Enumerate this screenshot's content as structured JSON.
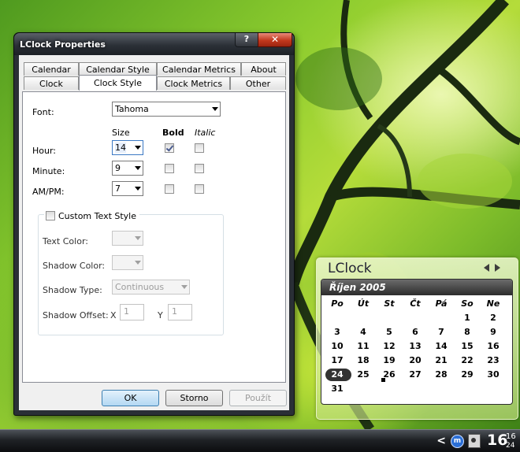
{
  "window": {
    "title": "LClock Properties",
    "help_label": "?",
    "close_label": "✕"
  },
  "tabs": {
    "row1": [
      "Calendar",
      "Calendar Style",
      "Calendar Metrics",
      "About"
    ],
    "row2": [
      "Clock",
      "Clock Style",
      "Clock Metrics",
      "Other"
    ],
    "active": "Clock Style"
  },
  "clock_style": {
    "font_label": "Font:",
    "font_value": "Tahoma",
    "size_header": "Size",
    "bold_header": "Bold",
    "italic_header": "Italic",
    "rows": [
      {
        "label": "Hour:",
        "size": "14",
        "bold": true,
        "italic": false
      },
      {
        "label": "Minute:",
        "size": "9",
        "bold": false,
        "italic": false
      },
      {
        "label": "AM/PM:",
        "size": "7",
        "bold": false,
        "italic": false
      }
    ],
    "custom_text_style_label": "Custom Text Style",
    "custom_text_style_checked": false,
    "text_color_label": "Text Color:",
    "shadow_color_label": "Shadow Color:",
    "shadow_type_label": "Shadow Type:",
    "shadow_type_value": "Continuous",
    "shadow_offset_label": "Shadow Offset:",
    "offset_x_label": "X",
    "offset_x_value": "1",
    "offset_y_label": "Y",
    "offset_y_value": "1"
  },
  "buttons": {
    "ok": "OK",
    "cancel": "Storno",
    "apply": "Použít"
  },
  "gadget": {
    "title": "LClock",
    "month": "Říjen  2005",
    "weekdays": [
      "Po",
      "Út",
      "St",
      "Čt",
      "Pá",
      "So",
      "Ne"
    ],
    "weeks": [
      [
        "",
        "",
        "",
        "",
        "",
        "1",
        "2"
      ],
      [
        "3",
        "4",
        "5",
        "6",
        "7",
        "8",
        "9"
      ],
      [
        "10",
        "11",
        "12",
        "13",
        "14",
        "15",
        "16"
      ],
      [
        "17",
        "18",
        "19",
        "20",
        "21",
        "22",
        "23"
      ],
      [
        "24",
        "25",
        "26",
        "27",
        "28",
        "29",
        "30"
      ],
      [
        "31",
        "",
        "",
        "",
        "",
        "",
        ""
      ]
    ],
    "today": "24"
  },
  "taskbar": {
    "chevron": "<",
    "tray_m": "m",
    "clock_hour": "16",
    "clock_minute": "16",
    "clock_second": "24"
  }
}
